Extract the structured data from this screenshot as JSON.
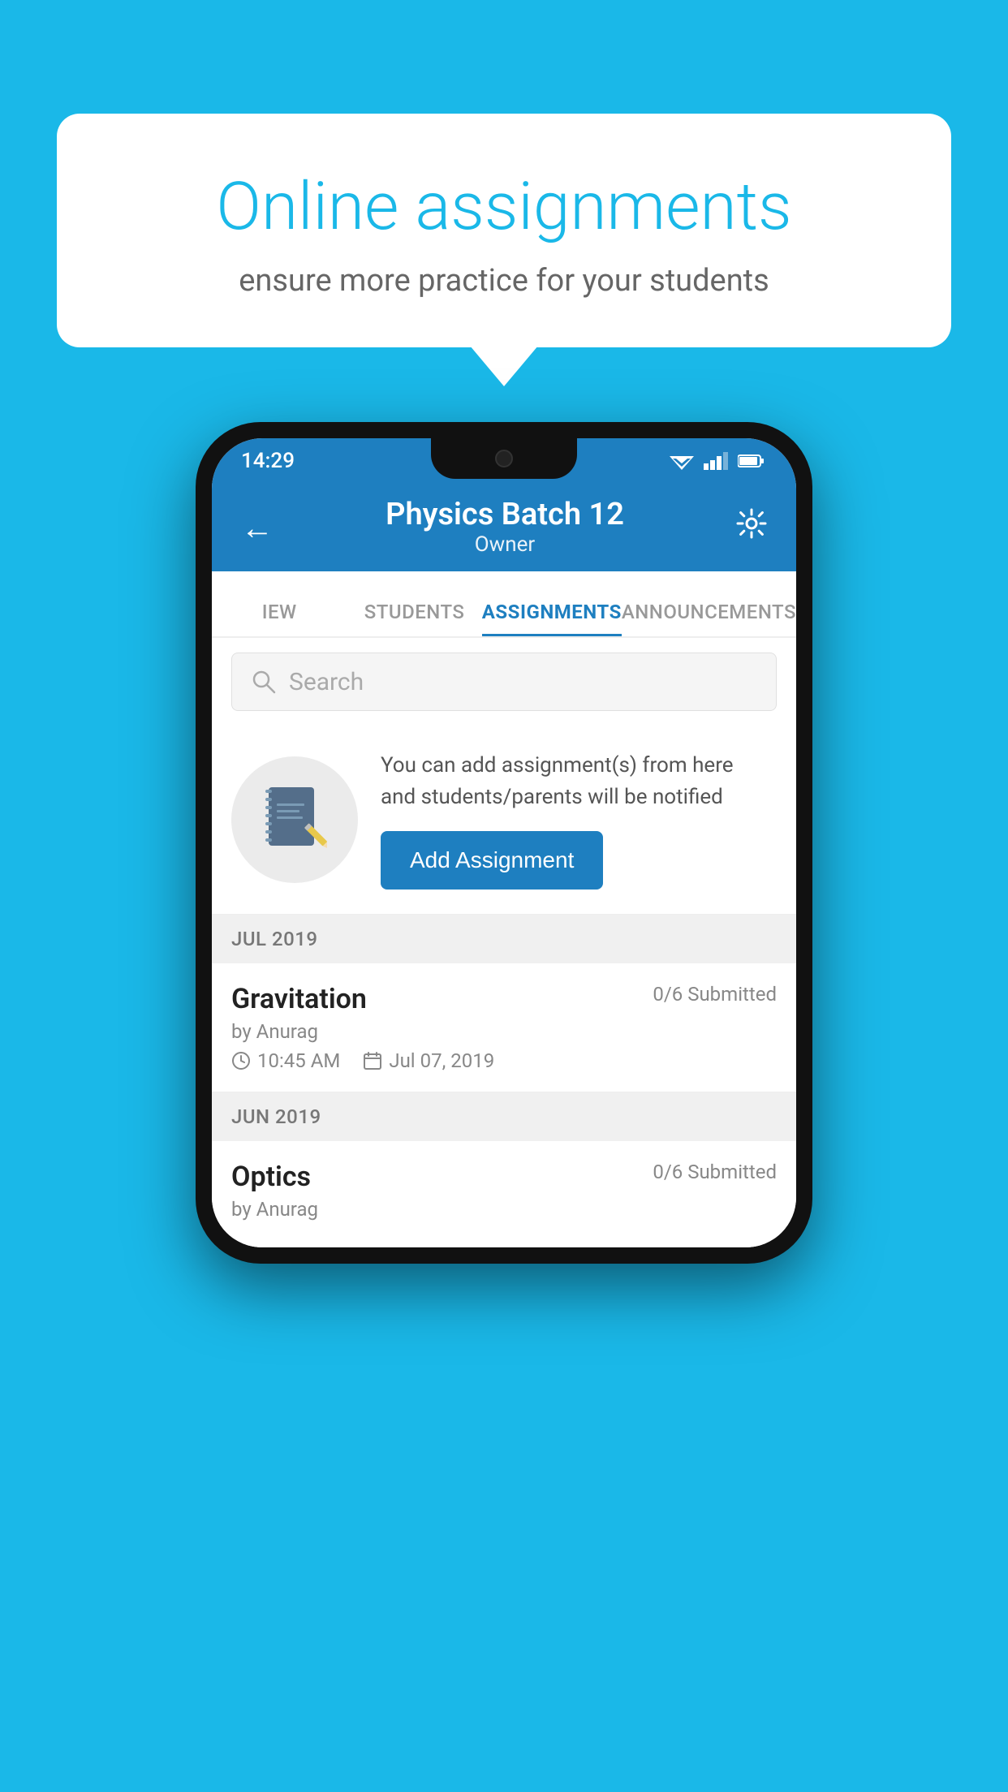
{
  "background_color": "#1ab8e8",
  "promo": {
    "title": "Online assignments",
    "subtitle": "ensure more practice for your students"
  },
  "status_bar": {
    "time": "14:29",
    "wifi": "▼",
    "signal": "▲",
    "battery": "▮"
  },
  "header": {
    "title": "Physics Batch 12",
    "subtitle": "Owner",
    "back_label": "←",
    "settings_label": "⚙"
  },
  "tabs": [
    {
      "label": "IEW",
      "active": false
    },
    {
      "label": "STUDENTS",
      "active": false
    },
    {
      "label": "ASSIGNMENTS",
      "active": true
    },
    {
      "label": "ANNOUNCEMENTS",
      "active": false
    }
  ],
  "search": {
    "placeholder": "Search"
  },
  "info_card": {
    "description": "You can add assignment(s) from here and students/parents will be notified",
    "button_label": "Add Assignment"
  },
  "sections": [
    {
      "header": "JUL 2019",
      "assignments": [
        {
          "name": "Gravitation",
          "submitted": "0/6 Submitted",
          "author": "by Anurag",
          "time": "10:45 AM",
          "date": "Jul 07, 2019"
        }
      ]
    },
    {
      "header": "JUN 2019",
      "assignments": [
        {
          "name": "Optics",
          "submitted": "0/6 Submitted",
          "author": "by Anurag",
          "time": "",
          "date": ""
        }
      ]
    }
  ]
}
